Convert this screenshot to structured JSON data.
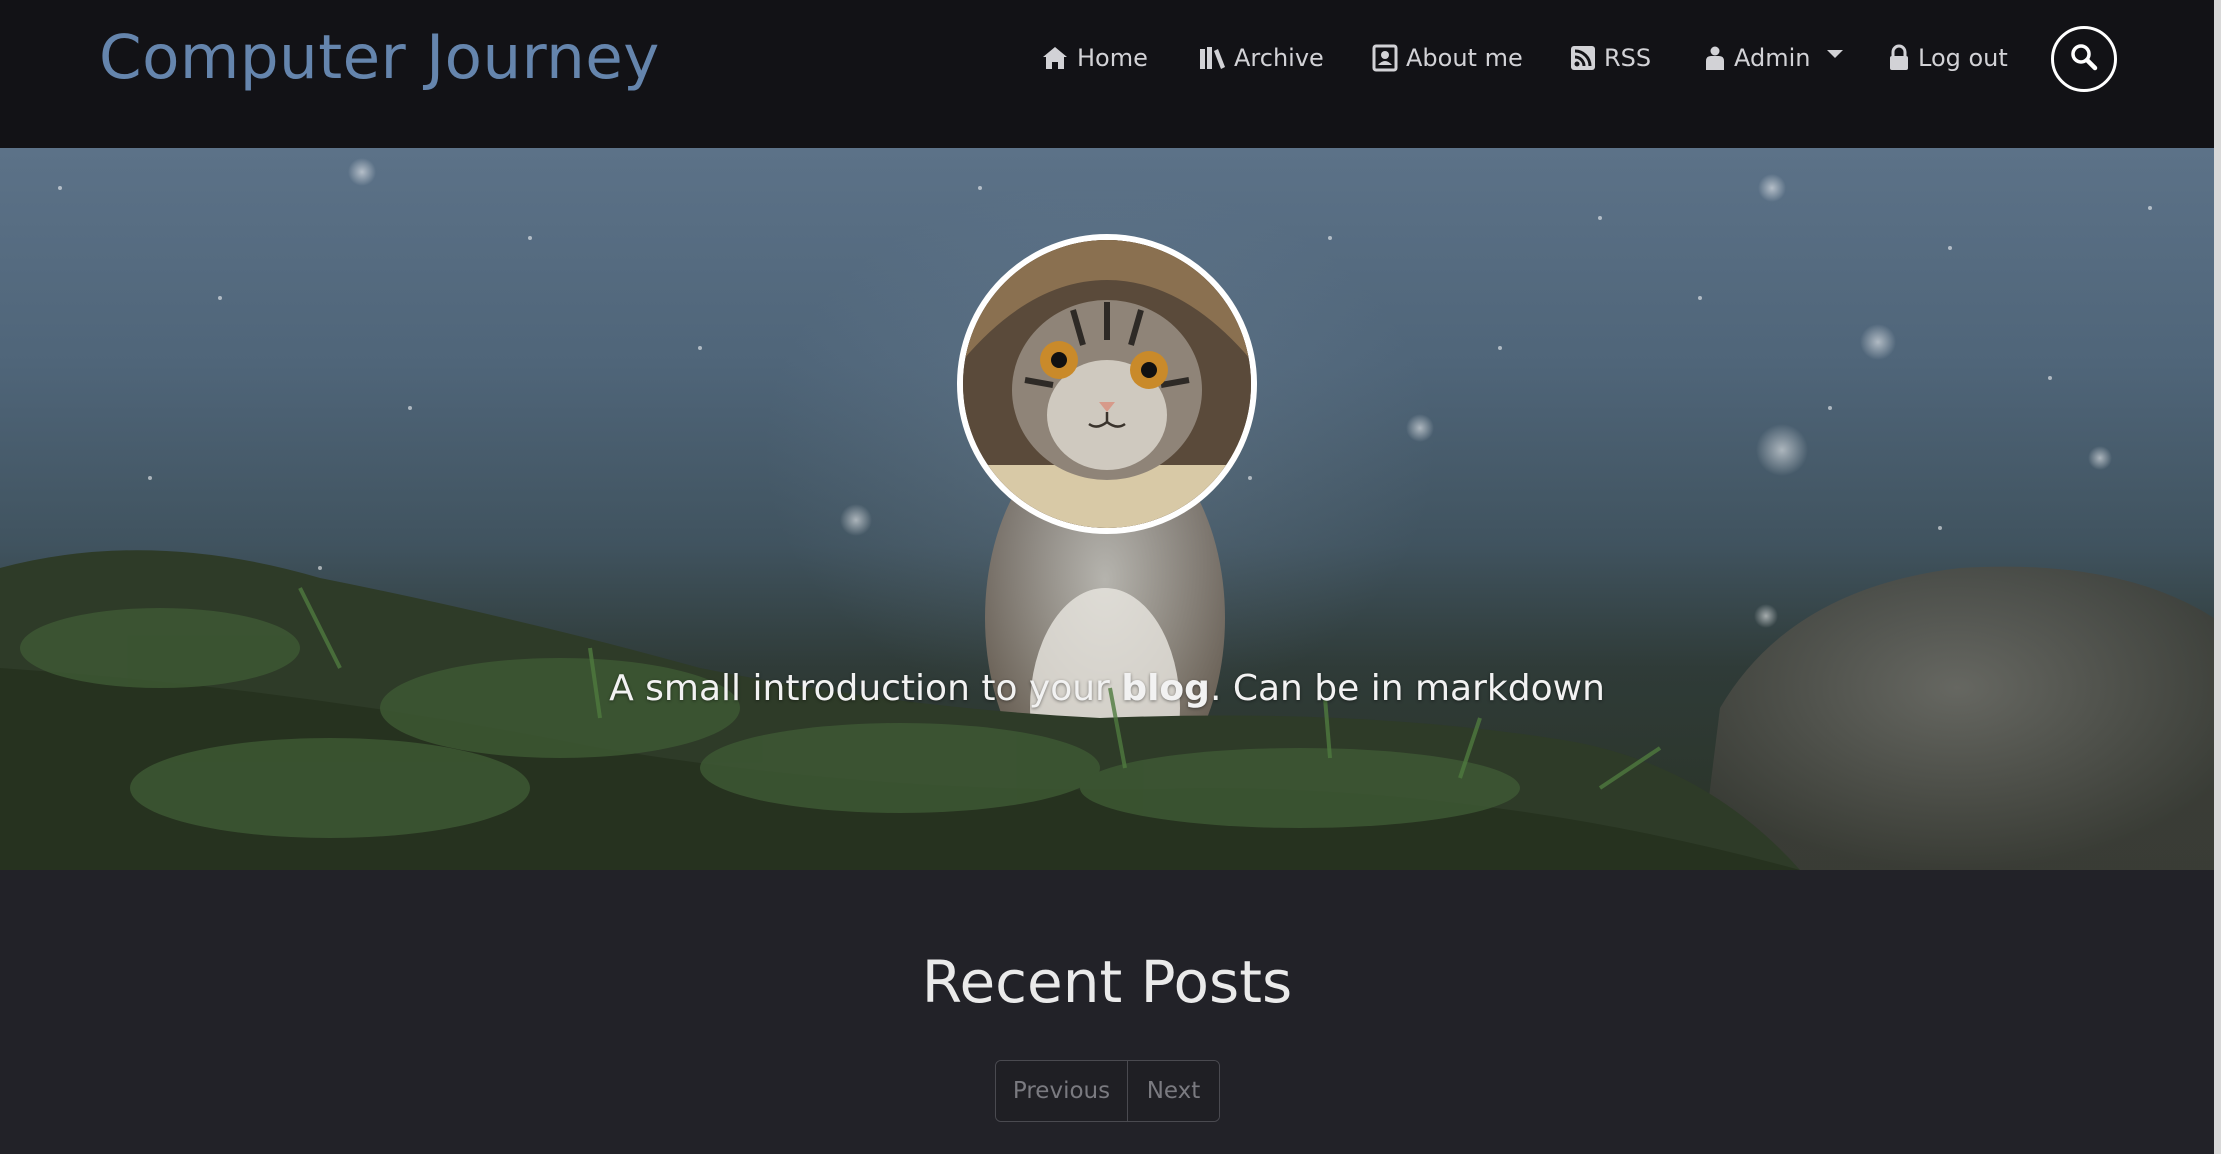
{
  "site": {
    "title": "Computer Journey"
  },
  "nav": {
    "items": [
      {
        "label": "Home",
        "icon": "home-icon"
      },
      {
        "label": "Archive",
        "icon": "books-icon"
      },
      {
        "label": "About me",
        "icon": "contact-card-icon"
      },
      {
        "label": "RSS",
        "icon": "rss-icon"
      },
      {
        "label": "Admin",
        "icon": "user-icon"
      },
      {
        "label": "Log out",
        "icon": "lock-icon"
      }
    ],
    "search_icon": "search-icon"
  },
  "hero": {
    "avatar": "cat-avatar",
    "intro_before": "A small introduction to your ",
    "intro_bold": "blog",
    "intro_after": ". Can be in markdown"
  },
  "recent": {
    "title": "Recent Posts",
    "previous_label": "Previous",
    "next_label": "Next"
  },
  "colors": {
    "navbar_bg": "#121216",
    "brand": "#6585ad",
    "page_bg": "#222228"
  }
}
